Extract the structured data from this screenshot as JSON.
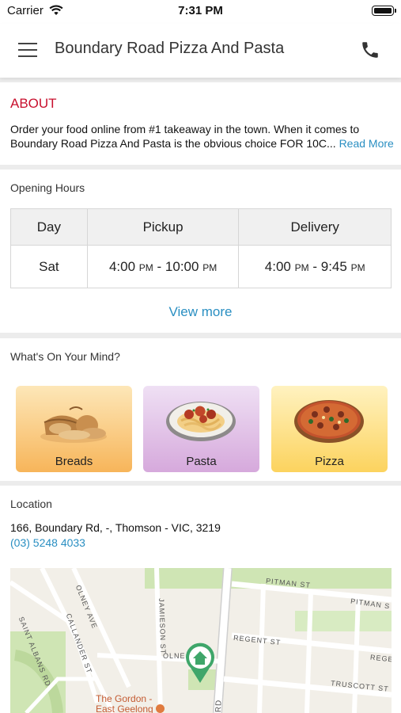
{
  "status_bar": {
    "carrier": "Carrier",
    "time": "7:31 PM"
  },
  "header": {
    "title": "Boundary Road Pizza And Pasta",
    "menu_icon": "menu-icon",
    "call_icon": "phone-icon"
  },
  "about": {
    "title": "ABOUT",
    "line1": "Order your food online from #1 takeaway in the town. When it comes to",
    "line2": "Boundary Road Pizza And Pasta is the obvious choice FOR 10C...",
    "read_more": "Read More"
  },
  "opening_hours": {
    "label": "Opening Hours",
    "columns": [
      "Day",
      "Pickup",
      "Delivery"
    ],
    "row": {
      "day": "Sat",
      "pickup_start": "4:00",
      "pickup_start_ampm": "PM",
      "pickup_sep": " - ",
      "pickup_end": "10:00",
      "pickup_end_ampm": "PM",
      "delivery_start": "4:00",
      "delivery_start_ampm": "PM",
      "delivery_sep": " - ",
      "delivery_end": "9:45",
      "delivery_end_ampm": "PM"
    },
    "view_more": "View more"
  },
  "whats_on_mind": {
    "label": "What's On Your Mind?",
    "categories": [
      {
        "name": "Breads"
      },
      {
        "name": "Pasta"
      },
      {
        "name": "Pizza"
      }
    ]
  },
  "location": {
    "label": "Location",
    "address": "166, Boundary Rd, -, Thomson - VIC, 3219",
    "phone": "(03) 5248 4033",
    "map": {
      "streets": [
        "PITMAN ST",
        "PITMAN S",
        "SAINT ALBANS RD",
        "OLNEY AVE",
        "JAMIESON ST",
        "CALLANDER ST",
        "REGENT ST",
        "REGE",
        "OLNE",
        "TRUSCOTT ST",
        "RD"
      ],
      "place_line1": "The Gordon -",
      "place_line2": "East Geelong",
      "marker_icon": "home-pin-icon"
    }
  },
  "colors": {
    "accent": "#c8102e",
    "link": "#2a8fc2",
    "marker": "#3fa66a"
  }
}
